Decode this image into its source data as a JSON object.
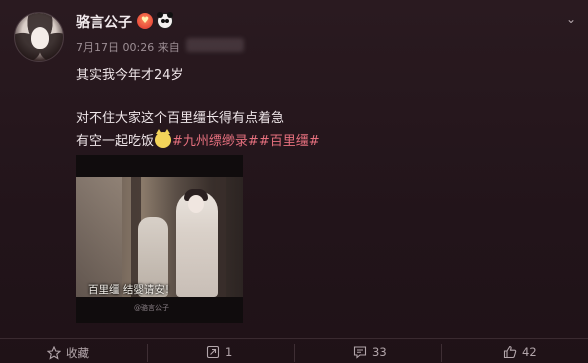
{
  "post": {
    "author": "骆言公子",
    "badges": [
      "heart-badge-icon",
      "panda-badge-icon"
    ],
    "meta": "7月17日 00:26 来自",
    "text": {
      "line1": "其实我今年才24岁",
      "line2": "对不住大家这个百里缰长得有点着急",
      "line3_prefix": "有空一起吃饭",
      "tag1": "#九州缥缈录#",
      "tag2": "#百里缰#"
    },
    "media": {
      "subtitle": "百里缰  结婴请安!",
      "watermark": "@骆言公子"
    }
  },
  "actions": {
    "favorite": "收藏",
    "repost": "1",
    "comment": "33",
    "like": "42"
  },
  "colors": {
    "background": "#22141a",
    "tag": "#e6707e"
  }
}
